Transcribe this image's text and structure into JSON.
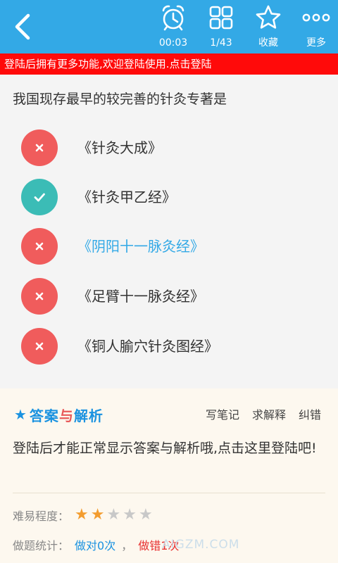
{
  "topbar": {
    "timer": "00:03",
    "progress": "1/43",
    "favorite": "收藏",
    "more": "更多"
  },
  "login_banner": "登陆后拥有更多功能,欢迎登陆使用.点击登陆",
  "question": "我国现存最早的较完善的针灸专著是",
  "options": [
    {
      "text": "《针灸大成》",
      "state": "wrong"
    },
    {
      "text": "《针灸甲乙经》",
      "state": "correct"
    },
    {
      "text": "《阴阳十一脉灸经》",
      "state": "wrong-selected"
    },
    {
      "text": "《足臂十一脉灸经》",
      "state": "wrong"
    },
    {
      "text": "《铜人腧穴针灸图经》",
      "state": "wrong"
    }
  ],
  "analysis": {
    "title_part1": "答案",
    "title_part2": "与",
    "title_part3": "解析",
    "actions": [
      "写笔记",
      "求解释",
      "纠错"
    ],
    "message": "登陆后才能正常显示答案与解析哦,点击这里登陆吧!",
    "difficulty_label": "难易程度：",
    "difficulty_rating": 2,
    "difficulty_max": 5,
    "stats_label": "做题统计：",
    "correct_count": "做对0次",
    "separator": "，",
    "wrong_count": "做错1次"
  },
  "watermark": "AIGZM.COM",
  "colors": {
    "topbar": "#33a9e6",
    "banner": "#ff0a0a",
    "wrong_mark": "#f05c5c",
    "correct_mark": "#3bbcb6",
    "star_on": "#f39c2e",
    "star_off": "#c8c8c8"
  }
}
